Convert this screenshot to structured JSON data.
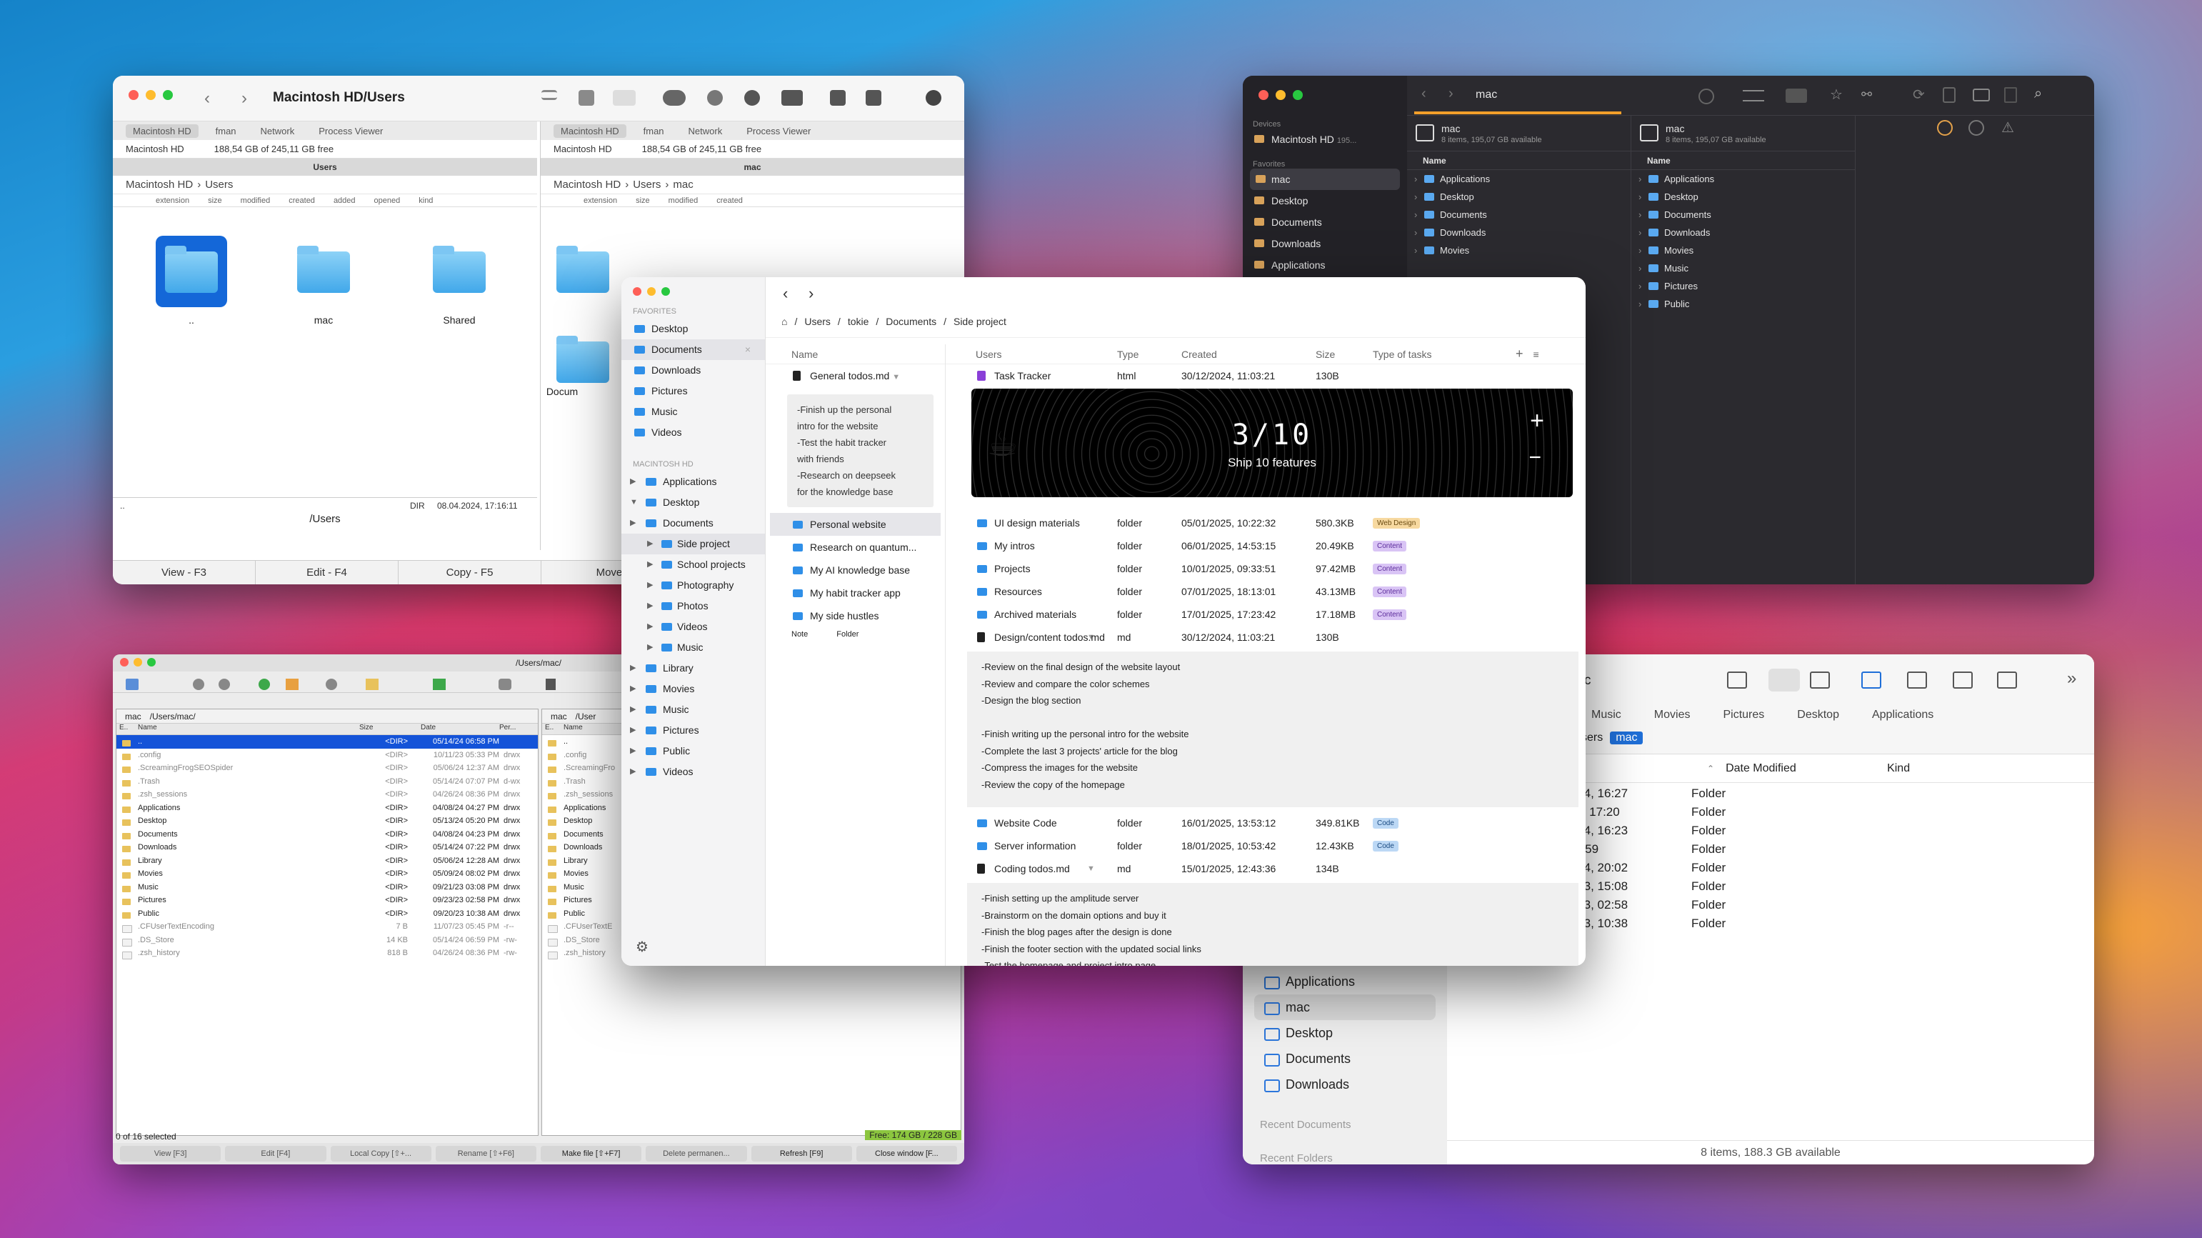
{
  "w1": {
    "title": "Macintosh HD/Users",
    "tabs": [
      "Macintosh HD",
      "fman",
      "Network",
      "Process Viewer"
    ],
    "device": "Macintosh HD",
    "free": "188,54 GB of 245,11 GB free",
    "left_header": "Users",
    "right_header": "mac",
    "left_path": [
      "Macintosh HD",
      "Users"
    ],
    "right_path": [
      "Macintosh HD",
      "Users",
      "mac"
    ],
    "cols": [
      "extension",
      "size",
      "modified",
      "created",
      "added",
      "opened",
      "kind"
    ],
    "left_items": [
      "..",
      "mac",
      "Shared"
    ],
    "right_items": [
      "Docum"
    ],
    "status_dir": "DIR",
    "status_date": "08.04.2024, 17:16:11",
    "status_dots": "..",
    "path_footer": "/Users",
    "fkeys": [
      "View - F3",
      "Edit - F4",
      "Copy - F5",
      "Move -"
    ]
  },
  "w2": {
    "title": "mac",
    "devices_h": "Devices",
    "device": "Macintosh HD",
    "device_size": "195...",
    "fav_h": "Favorites",
    "favs": [
      "mac",
      "Desktop",
      "Documents",
      "Downloads",
      "Applications"
    ],
    "pane_name": "mac",
    "pane_info": "8 items, 195,07 GB available",
    "name_col": "Name",
    "rows": [
      "Applications",
      "Desktop",
      "Documents",
      "Downloads",
      "Movies",
      "Music",
      "Pictures",
      "Public"
    ]
  },
  "w3": {
    "title": "/Users/mac/",
    "left_drive": "mac",
    "left_path": "/Users/mac/",
    "right_drive": "mac",
    "right_path": "/User",
    "hdr": [
      "E..",
      "Name",
      "Size",
      "Date",
      "Per..."
    ],
    "rows": [
      {
        "n": "..",
        "s": "<DIR>",
        "d": "05/14/24 06:58 PM",
        "p": "",
        "sel": true
      },
      {
        "n": ".config",
        "s": "<DIR>",
        "d": "10/11/23 05:33 PM",
        "p": "drwx",
        "h": true
      },
      {
        "n": ".ScreamingFrogSEOSpider",
        "s": "<DIR>",
        "d": "05/06/24 12:37 AM",
        "p": "drwx",
        "h": true
      },
      {
        "n": ".Trash",
        "s": "<DIR>",
        "d": "05/14/24 07:07 PM",
        "p": "d-wx",
        "h": true
      },
      {
        "n": ".zsh_sessions",
        "s": "<DIR>",
        "d": "04/26/24 08:36 PM",
        "p": "drwx",
        "h": true
      },
      {
        "n": "Applications",
        "s": "<DIR>",
        "d": "04/08/24 04:27 PM",
        "p": "drwx"
      },
      {
        "n": "Desktop",
        "s": "<DIR>",
        "d": "05/13/24 05:20 PM",
        "p": "drwx"
      },
      {
        "n": "Documents",
        "s": "<DIR>",
        "d": "04/08/24 04:23 PM",
        "p": "drwx"
      },
      {
        "n": "Downloads",
        "s": "<DIR>",
        "d": "05/14/24 07:22 PM",
        "p": "drwx"
      },
      {
        "n": "Library",
        "s": "<DIR>",
        "d": "05/06/24 12:28 AM",
        "p": "drwx"
      },
      {
        "n": "Movies",
        "s": "<DIR>",
        "d": "05/09/24 08:02 PM",
        "p": "drwx"
      },
      {
        "n": "Music",
        "s": "<DIR>",
        "d": "09/21/23 03:08 PM",
        "p": "drwx"
      },
      {
        "n": "Pictures",
        "s": "<DIR>",
        "d": "09/23/23 02:58 PM",
        "p": "drwx"
      },
      {
        "n": "Public",
        "s": "<DIR>",
        "d": "09/20/23 10:38 AM",
        "p": "drwx"
      },
      {
        "n": ".CFUserTextEncoding",
        "s": "7 B",
        "d": "11/07/23 05:45 PM",
        "p": "-r--",
        "f": true,
        "h": true
      },
      {
        "n": ".DS_Store",
        "s": "14 KB",
        "d": "05/14/24 06:59 PM",
        "p": "-rw-",
        "f": true,
        "h": true
      },
      {
        "n": ".zsh_history",
        "s": "818 B",
        "d": "04/26/24 08:36 PM",
        "p": "-rw-",
        "f": true,
        "h": true
      }
    ],
    "right_rows": [
      "..",
      ".config",
      ".ScreamingFro",
      ".Trash",
      ".zsh_sessions",
      "Applications",
      "Desktop",
      "Documents",
      "Downloads",
      "Library",
      "Movies",
      "Music",
      "Pictures",
      "Public",
      ".CFUserTextE",
      ".DS_Store",
      ".zsh_history"
    ],
    "selected": "0 of 16 selected",
    "free": "Free: 174 GB / 228 GB",
    "btns": [
      "View [F3]",
      "Edit [F4]",
      "Local Copy [⇧+...",
      "Rename [⇧+F6]",
      "Make file [⇧+F7]",
      "Delete permanen...",
      "Refresh [F9]",
      "Close window [F..."
    ]
  },
  "w4": {
    "title_frag": "c",
    "tabs": [
      "Music",
      "Movies",
      "Pictures",
      "Desktop",
      "Applications"
    ],
    "crumb": [
      "sers",
      "mac"
    ],
    "col_date": "Date Modified",
    "col_kind": "Kind",
    "rows": [
      [
        "08.04.2024, 16:27",
        "Folder"
      ],
      [
        "Yesterday, 17:20",
        "Folder"
      ],
      [
        "08.04.2024, 16:23",
        "Folder"
      ],
      [
        "Today, 18:59",
        "Folder"
      ],
      [
        "09.05.2024, 20:02",
        "Folder"
      ],
      [
        "21.09.2023, 15:08",
        "Folder"
      ],
      [
        "23.09.2023, 02:58",
        "Folder"
      ],
      [
        "20.09.2023, 10:38",
        "Folder"
      ]
    ],
    "side": [
      "Applications",
      "mac",
      "Desktop",
      "Documents",
      "Downloads"
    ],
    "recent_docs": "Recent Documents",
    "recent_folders": "Recent Folders",
    "footer": "8 items, 188.3 GB available"
  },
  "w5": {
    "fav_h": "FAVORITES",
    "favs": [
      "Desktop",
      "Documents",
      "Downloads",
      "Pictures",
      "Music",
      "Videos"
    ],
    "mac_h": "MACINTOSH HD",
    "tree": [
      [
        "Applications",
        0
      ],
      [
        "Desktop",
        0
      ],
      [
        "Documents",
        0
      ],
      [
        "Side project",
        1
      ],
      [
        "School projects",
        1
      ],
      [
        "Photography",
        1
      ],
      [
        "Photos",
        1
      ],
      [
        "Videos",
        1
      ],
      [
        "Music",
        1
      ],
      [
        "Library",
        0
      ],
      [
        "Movies",
        0
      ],
      [
        "Music",
        0
      ],
      [
        "Pictures",
        0
      ],
      [
        "Public",
        0
      ],
      [
        "Videos",
        0
      ]
    ],
    "crumb": [
      "Users",
      "tokie",
      "Documents",
      "Side project"
    ],
    "mid_hdr": "Name",
    "mid_doc": "General todos.md",
    "mid_note": "-Finish up the personal\nintro for the website\n-Test the habit tracker\nwith friends\n-Research on deepseek\nfor the knowledge base",
    "mid_rows": [
      "Personal website",
      "Research on quantum...",
      "My AI knowledge base",
      "My habit tracker app",
      "My side hustles"
    ],
    "mid_foot": [
      "Note",
      "Folder"
    ],
    "rhdr": [
      "Users",
      "Type",
      "Created",
      "Size",
      "Type of tasks"
    ],
    "task": {
      "n": "Task Tracker",
      "t": "html",
      "d": "30/12/2024, 11:03:21",
      "s": "130B"
    },
    "banner_num": "3/10",
    "banner_sub": "Ship 10 features",
    "rows1": [
      {
        "n": "UI design materials",
        "t": "folder",
        "d": "05/01/2025, 10:22:32",
        "s": "580.3KB",
        "tag": "Web Design",
        "c": "web"
      },
      {
        "n": "My intros",
        "t": "folder",
        "d": "06/01/2025, 14:53:15",
        "s": "20.49KB",
        "tag": "Content",
        "c": "con"
      },
      {
        "n": "Projects",
        "t": "folder",
        "d": "10/01/2025, 09:33:51",
        "s": "97.42MB",
        "tag": "Content",
        "c": "con"
      },
      {
        "n": "Resources",
        "t": "folder",
        "d": "07/01/2025, 18:13:01",
        "s": "43.13MB",
        "tag": "Content",
        "c": "con"
      },
      {
        "n": "Archived materials",
        "t": "folder",
        "d": "17/01/2025, 17:23:42",
        "s": "17.18MB",
        "tag": "Content",
        "c": "con"
      }
    ],
    "doc1": {
      "n": "Design/content todos.md",
      "t": "md",
      "d": "30/12/2024, 11:03:21",
      "s": "130B"
    },
    "note1": "-Review on the final design of the website layout\n-Review and compare the color schemes\n-Design the blog section\n\n-Finish writing up the personal intro for the website\n-Complete the last 3 projects' article for the blog\n-Compress the images for the website\n-Review the copy of the homepage",
    "rows2": [
      {
        "n": "Website Code",
        "t": "folder",
        "d": "16/01/2025, 13:53:12",
        "s": "349.81KB",
        "tag": "Code",
        "c": "cod"
      },
      {
        "n": "Server information",
        "t": "folder",
        "d": "18/01/2025, 10:53:42",
        "s": "12.43KB",
        "tag": "Code",
        "c": "cod"
      }
    ],
    "doc2": {
      "n": "Coding todos.md",
      "t": "md",
      "d": "15/01/2025, 12:43:36",
      "s": "134B"
    },
    "note2": "-Finish setting up the amplitude server\n-Brainstorm on the domain options and buy it\n-Finish the blog pages after the design is done\n-Finish the footer section with the updated social links\n-Test the homepage and project intro page"
  }
}
